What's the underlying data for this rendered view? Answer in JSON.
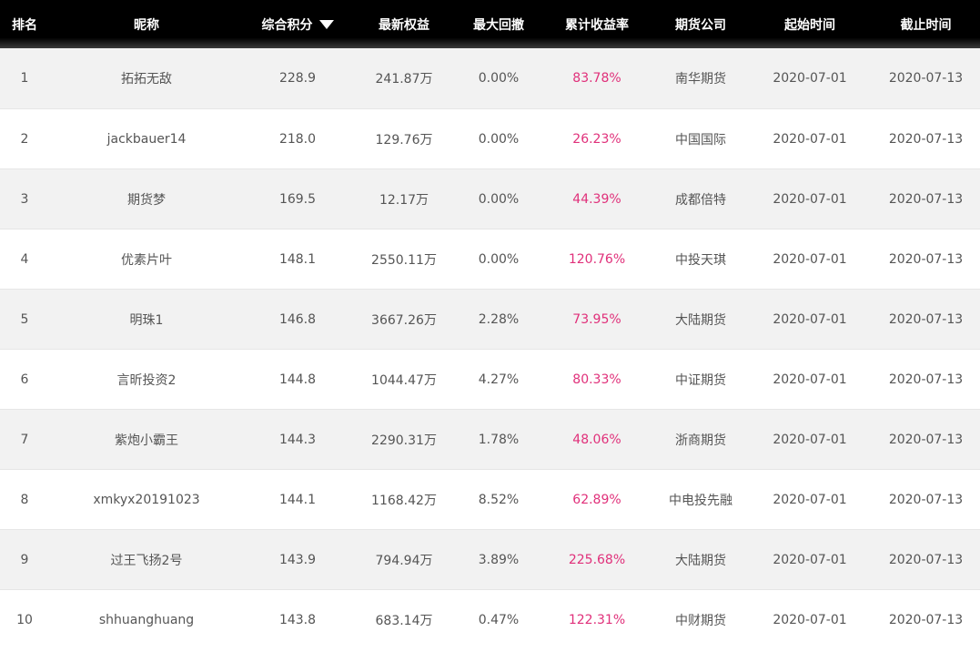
{
  "header": {
    "rank": "排名",
    "nickname": "昵称",
    "score": "综合积分",
    "equity": "最新权益",
    "max_drawdown": "最大回撤",
    "cum_return": "累计收益率",
    "broker": "期货公司",
    "start": "起始时间",
    "end": "截止时间",
    "sort_icon": "caret-down-icon"
  },
  "colors": {
    "header_bg": "#000000",
    "return_text": "#e0307a",
    "alt_row_bg": "#f2f2f2"
  },
  "rows": [
    {
      "rank": "1",
      "nickname": "拓拓无敌",
      "score": "228.9",
      "equity": "241.87万",
      "max_drawdown": "0.00%",
      "cum_return": "83.78%",
      "broker": "南华期货",
      "start": "2020-07-01",
      "end": "2020-07-13"
    },
    {
      "rank": "2",
      "nickname": "jackbauer14",
      "score": "218.0",
      "equity": "129.76万",
      "max_drawdown": "0.00%",
      "cum_return": "26.23%",
      "broker": "中国国际",
      "start": "2020-07-01",
      "end": "2020-07-13"
    },
    {
      "rank": "3",
      "nickname": "期货梦",
      "score": "169.5",
      "equity": "12.17万",
      "max_drawdown": "0.00%",
      "cum_return": "44.39%",
      "broker": "成都倍特",
      "start": "2020-07-01",
      "end": "2020-07-13"
    },
    {
      "rank": "4",
      "nickname": "优素片叶",
      "score": "148.1",
      "equity": "2550.11万",
      "max_drawdown": "0.00%",
      "cum_return": "120.76%",
      "broker": "中投天琪",
      "start": "2020-07-01",
      "end": "2020-07-13"
    },
    {
      "rank": "5",
      "nickname": "明珠1",
      "score": "146.8",
      "equity": "3667.26万",
      "max_drawdown": "2.28%",
      "cum_return": "73.95%",
      "broker": "大陆期货",
      "start": "2020-07-01",
      "end": "2020-07-13"
    },
    {
      "rank": "6",
      "nickname": "言昕投资2",
      "score": "144.8",
      "equity": "1044.47万",
      "max_drawdown": "4.27%",
      "cum_return": "80.33%",
      "broker": "中证期货",
      "start": "2020-07-01",
      "end": "2020-07-13"
    },
    {
      "rank": "7",
      "nickname": "紫炮小霸王",
      "score": "144.3",
      "equity": "2290.31万",
      "max_drawdown": "1.78%",
      "cum_return": "48.06%",
      "broker": "浙商期货",
      "start": "2020-07-01",
      "end": "2020-07-13"
    },
    {
      "rank": "8",
      "nickname": "xmkyx20191023",
      "score": "144.1",
      "equity": "1168.42万",
      "max_drawdown": "8.52%",
      "cum_return": "62.89%",
      "broker": "中电投先融",
      "start": "2020-07-01",
      "end": "2020-07-13"
    },
    {
      "rank": "9",
      "nickname": "过王飞扬2号",
      "score": "143.9",
      "equity": "794.94万",
      "max_drawdown": "3.89%",
      "cum_return": "225.68%",
      "broker": "大陆期货",
      "start": "2020-07-01",
      "end": "2020-07-13"
    },
    {
      "rank": "10",
      "nickname": "shhuanghuang",
      "score": "143.8",
      "equity": "683.14万",
      "max_drawdown": "0.47%",
      "cum_return": "122.31%",
      "broker": "中财期货",
      "start": "2020-07-01",
      "end": "2020-07-13"
    }
  ]
}
